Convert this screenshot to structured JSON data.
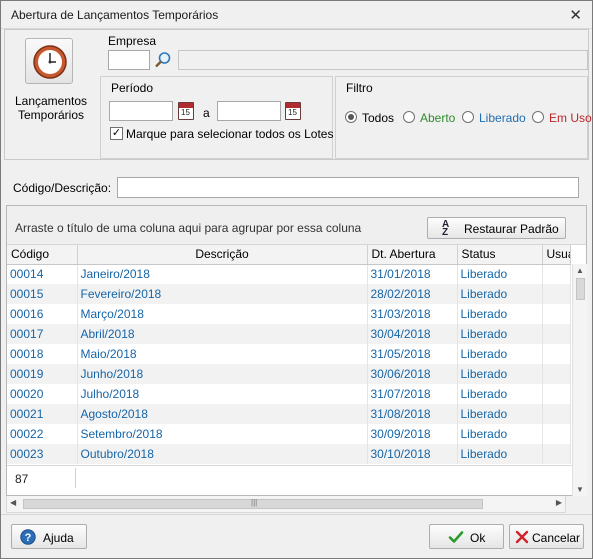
{
  "window": {
    "title": "Abertura de Lançamentos Temporários",
    "close_glyph": "✕"
  },
  "module": {
    "label_line1": "Lançamentos",
    "label_line2": "Temporários",
    "icon": "clock-icon"
  },
  "empresa": {
    "title": "Empresa",
    "code_value": "",
    "name_value": "",
    "search_icon": "search-icon"
  },
  "periodo": {
    "title": "Período",
    "start_value": "",
    "separator": "a",
    "end_value": "",
    "calendar_day": "15",
    "select_all_label": "Marque para selecionar todos os Lotes",
    "select_all_checked": "✓"
  },
  "filtro": {
    "title": "Filtro",
    "options": [
      {
        "label": "Todos",
        "color": "#1a1a1a",
        "selected": true
      },
      {
        "label": "Aberto",
        "color": "#2e8b2e",
        "selected": false
      },
      {
        "label": "Liberado",
        "color": "#1f6fb2",
        "selected": false
      },
      {
        "label": "Em Uso",
        "color": "#c0252a",
        "selected": false
      }
    ]
  },
  "search": {
    "label": "Código/Descrição:",
    "value": ""
  },
  "grid": {
    "group_hint": "Arraste o título de uma coluna aqui para agrupar por essa coluna",
    "restore_label": "Restaurar Padrão",
    "columns": [
      "Código",
      "Descrição",
      "Dt. Abertura",
      "Status",
      "Usuá"
    ],
    "rows": [
      [
        "00014",
        "Janeiro/2018",
        "31/01/2018",
        "Liberado"
      ],
      [
        "00015",
        "Fevereiro/2018",
        "28/02/2018",
        "Liberado"
      ],
      [
        "00016",
        "Março/2018",
        "31/03/2018",
        "Liberado"
      ],
      [
        "00017",
        "Abril/2018",
        "30/04/2018",
        "Liberado"
      ],
      [
        "00018",
        "Maio/2018",
        "31/05/2018",
        "Liberado"
      ],
      [
        "00019",
        "Junho/2018",
        "30/06/2018",
        "Liberado"
      ],
      [
        "00020",
        "Julho/2018",
        "31/07/2018",
        "Liberado"
      ],
      [
        "00021",
        "Agosto/2018",
        "31/08/2018",
        "Liberado"
      ],
      [
        "00022",
        "Setembro/2018",
        "30/09/2018",
        "Liberado"
      ],
      [
        "00023",
        "Outubro/2018",
        "30/10/2018",
        "Liberado"
      ]
    ],
    "footer_count": "87",
    "accent_text_color": "#1565a8"
  },
  "buttons": {
    "help_label": "Ajuda",
    "ok_label": "Ok",
    "cancel_label": "Cancelar"
  }
}
